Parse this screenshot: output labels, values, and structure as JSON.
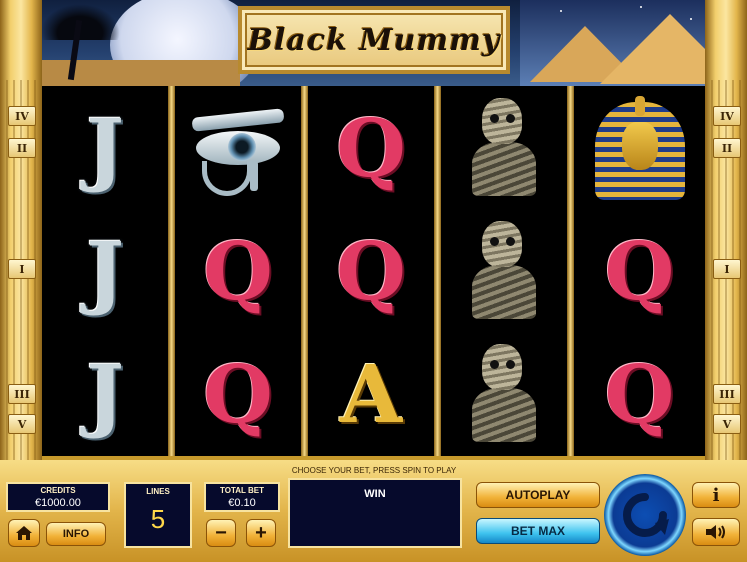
{
  "game": {
    "title": "Black Mummy"
  },
  "paylines": {
    "left": [
      "IV",
      "II",
      "I",
      "III",
      "V"
    ],
    "right": [
      "IV",
      "II",
      "I",
      "III",
      "V"
    ]
  },
  "reels": [
    [
      "J",
      "J",
      "J"
    ],
    [
      "eye-of-horus",
      "Q",
      "Q"
    ],
    [
      "Q",
      "Q",
      "A"
    ],
    [
      "mummy",
      "mummy",
      "mummy"
    ],
    [
      "pharaoh",
      "Q",
      "Q"
    ]
  ],
  "panel": {
    "hint": "CHOOSE YOUR BET, PRESS SPIN TO PLAY",
    "credits_label": "CREDITS",
    "credits_value": "€1000.00",
    "lines_label": "LINES",
    "lines_value": "5",
    "total_bet_label": "TOTAL BET",
    "total_bet_value": "€0.10",
    "win_label": "WIN",
    "info_label": "INFO",
    "minus_label": "−",
    "plus_label": "+",
    "autoplay_label": "AUTOPLAY",
    "betmax_label": "BET MAX",
    "info_icon_label": "i"
  },
  "colors": {
    "gold": "#e2b44a",
    "dark_box": "#060a2c",
    "autoplay": "#f1b238",
    "betmax": "#3ec3ef",
    "spin": "#0b3b94"
  },
  "icons": [
    "home-icon",
    "spin-icon",
    "info-icon",
    "sound-icon"
  ]
}
